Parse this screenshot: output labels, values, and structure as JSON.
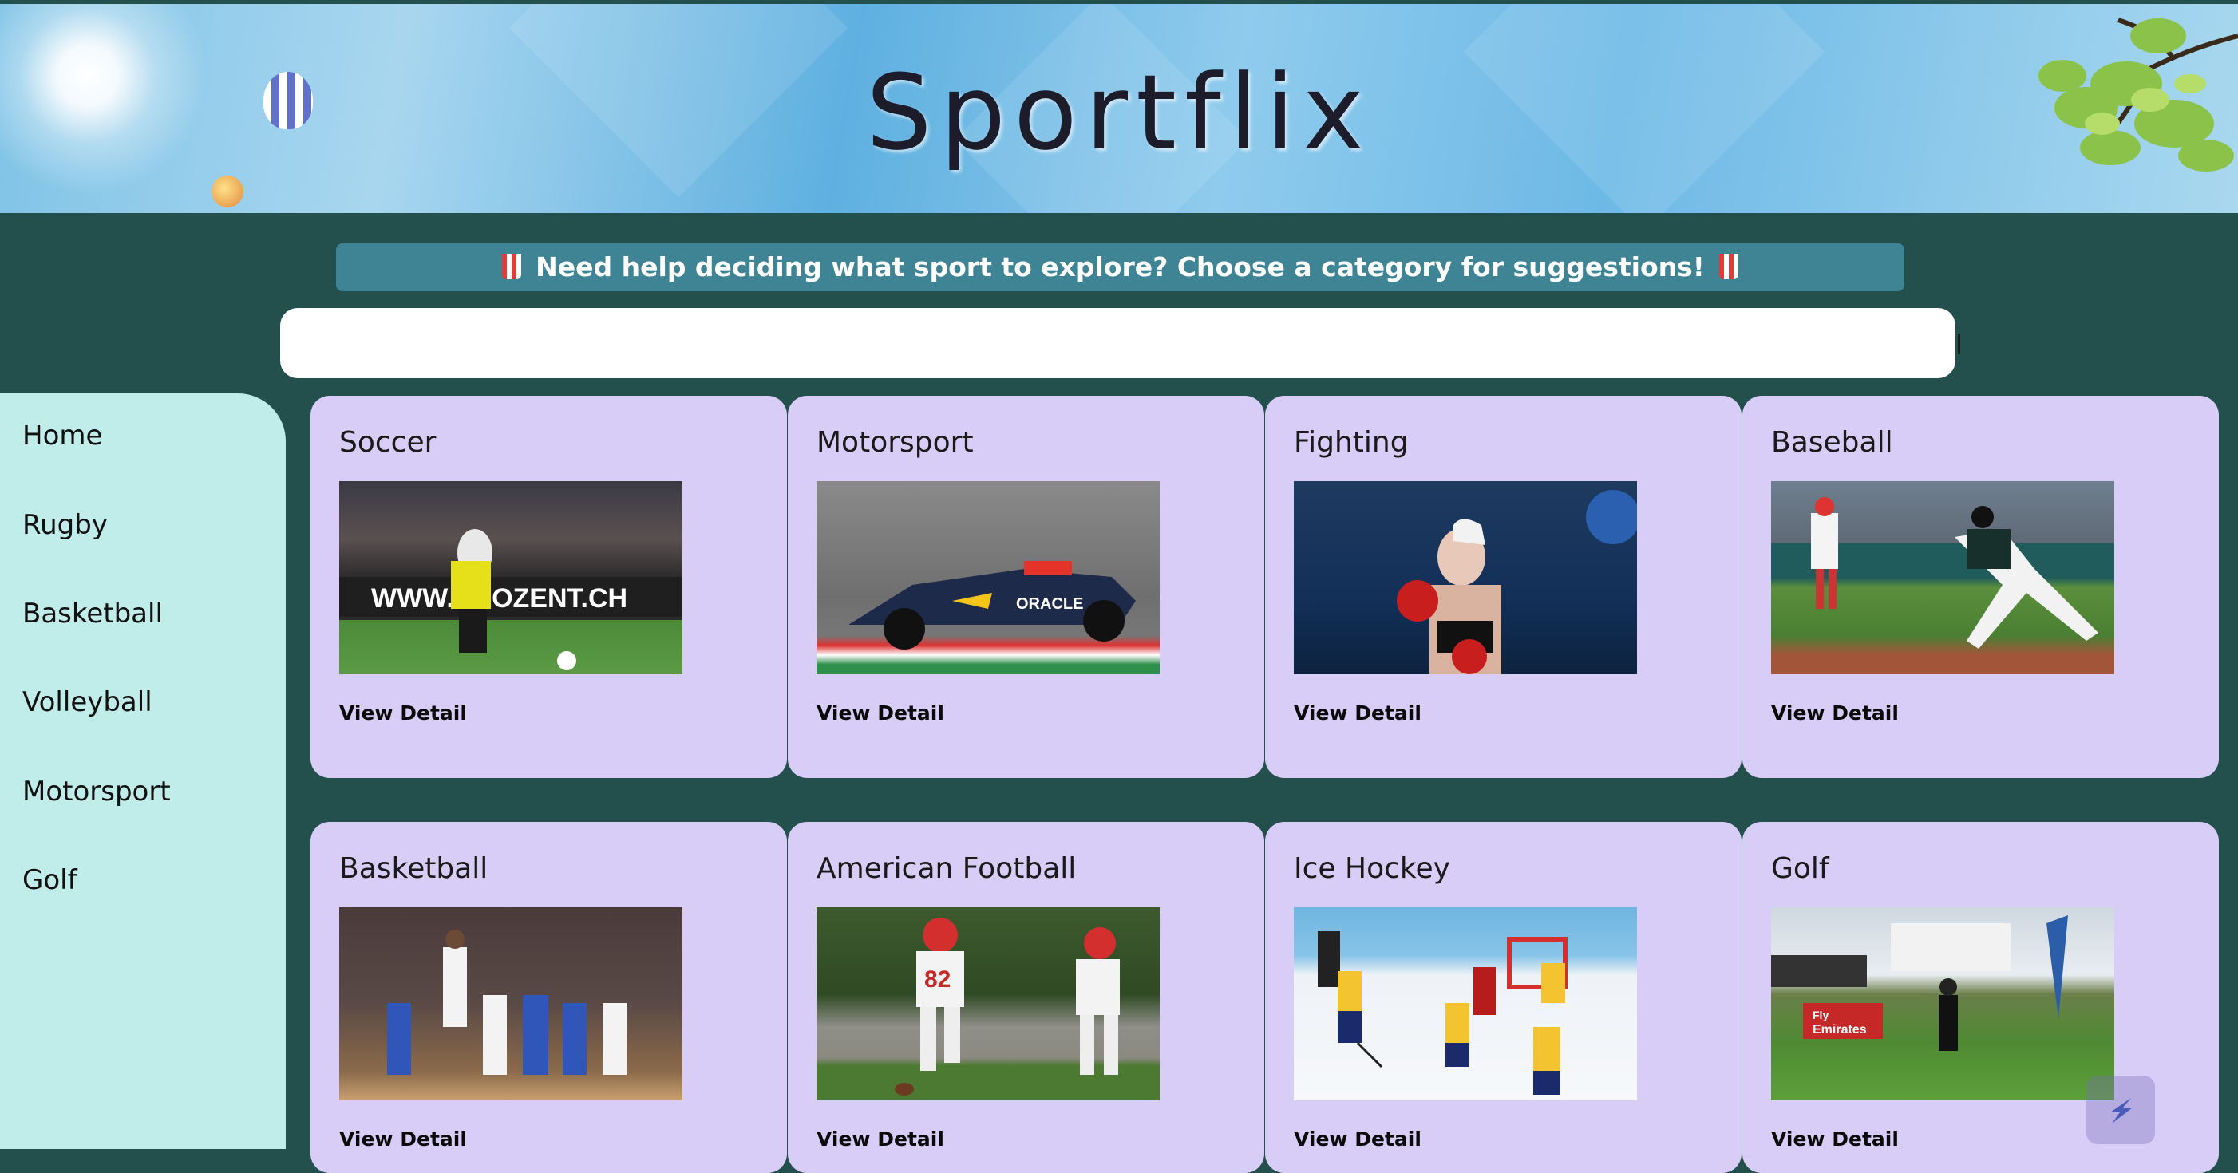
{
  "header": {
    "title": "Sportflix"
  },
  "suggestion": {
    "text": "Need help deciding what sport to explore? Choose a category for suggestions!"
  },
  "search": {
    "value": "",
    "placeholder": ""
  },
  "sidebar": {
    "items": [
      {
        "label": "Home"
      },
      {
        "label": "Rugby"
      },
      {
        "label": "Basketball"
      },
      {
        "label": "Volleyball"
      },
      {
        "label": "Motorsport"
      },
      {
        "label": "Golf"
      }
    ]
  },
  "cards": [
    {
      "title": "Soccer",
      "link": "View Detail"
    },
    {
      "title": "Motorsport",
      "link": "View Detail"
    },
    {
      "title": "Fighting",
      "link": "View Detail"
    },
    {
      "title": "Baseball",
      "link": "View Detail"
    },
    {
      "title": "Basketball",
      "link": "View Detail"
    },
    {
      "title": "American Football",
      "link": "View Detail"
    },
    {
      "title": "Ice Hockey",
      "link": "View Detail"
    },
    {
      "title": "Golf",
      "link": "View Detail"
    }
  ],
  "colors": {
    "page_bg": "#234f4d",
    "sidebar_bg": "#c0ece9",
    "card_bg": "#d7cdf7",
    "suggest_bg": "#3e8494"
  },
  "icons": [
    "popcorn-icon",
    "balloon-icon",
    "sun-icon",
    "tree-icon",
    "assistant-icon"
  ]
}
